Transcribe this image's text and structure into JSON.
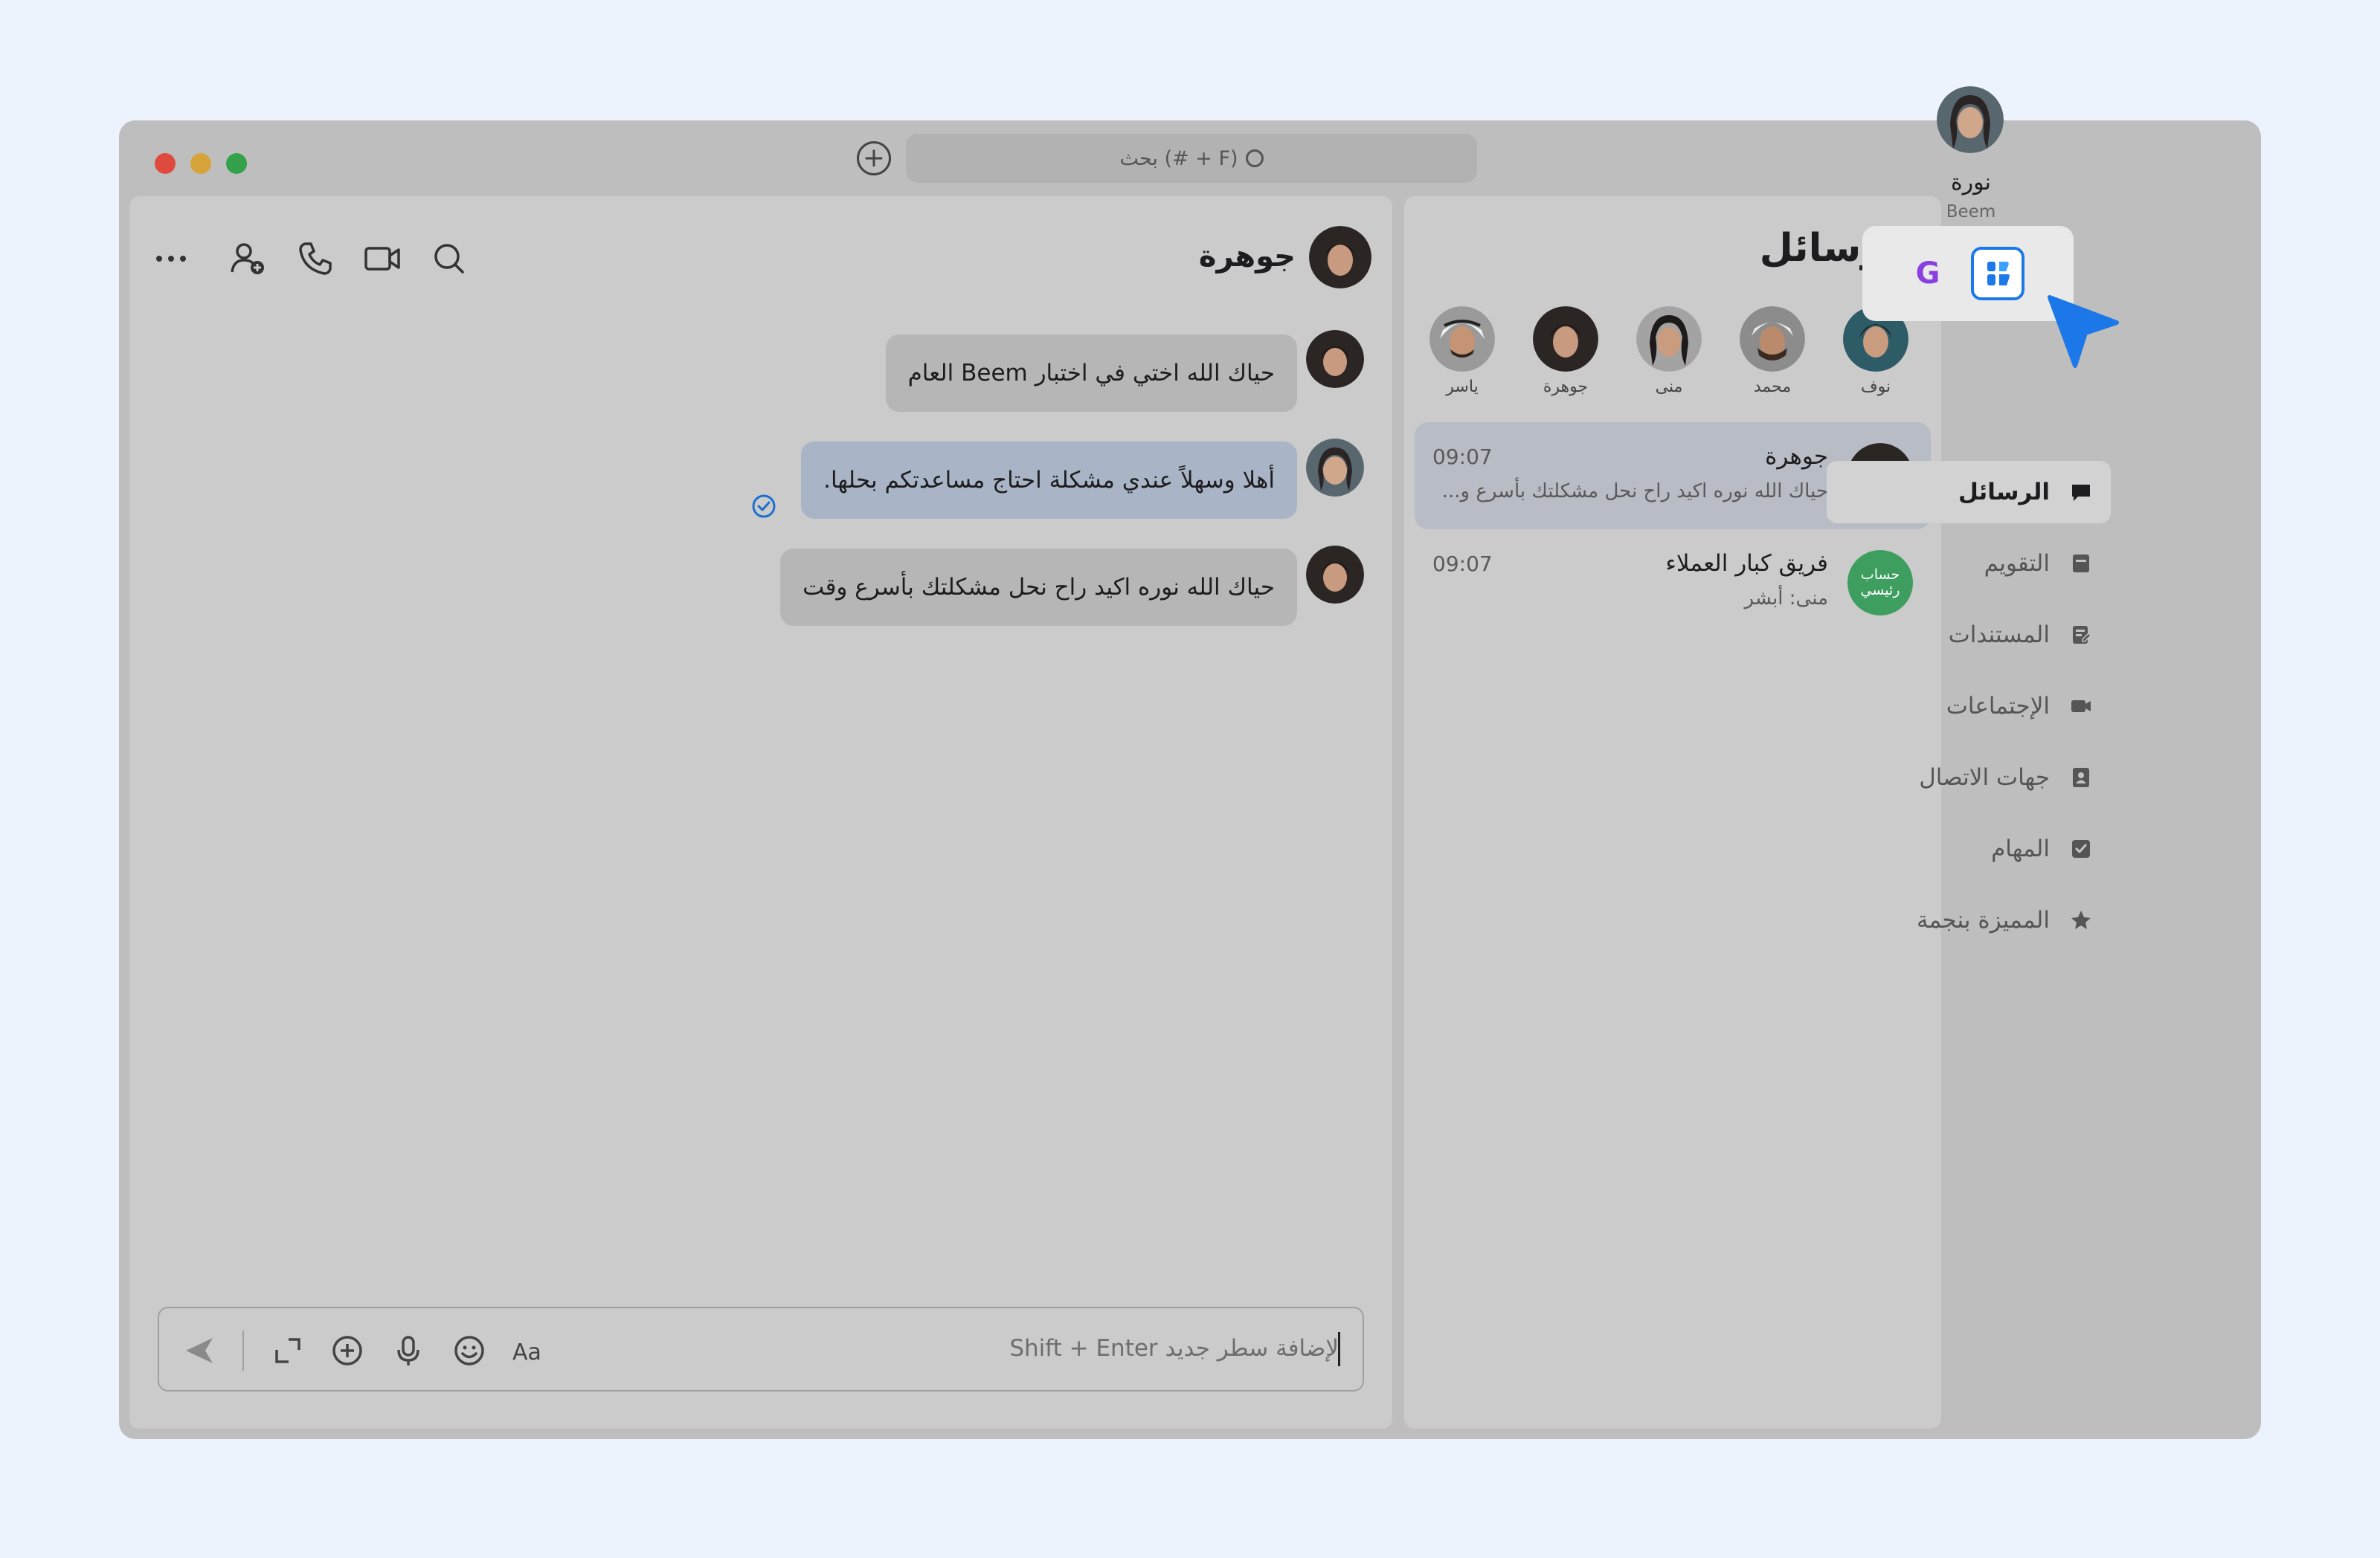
{
  "window": {
    "search_placeholder": "بحث (# + F)"
  },
  "chat": {
    "title": "جوهرة",
    "messages": [
      {
        "text": "حياك الله اختي في اختبار Beem العام",
        "sender": "جوهرة"
      },
      {
        "text": "أهلا وسهلاً عندي مشكلة احتاج مساعدتكم بحلها.",
        "sender": "نورة",
        "status": "read"
      },
      {
        "text": "حياك الله نوره اكيد راح نحل مشكلتك بأسرع وقت",
        "sender": "جوهرة"
      }
    ],
    "composer_placeholder": "Shift + Enter  لإضافة سطر جديد"
  },
  "messages_panel": {
    "title": "الرسائل",
    "stories": [
      {
        "name": "نوف"
      },
      {
        "name": "محمد"
      },
      {
        "name": "منى"
      },
      {
        "name": "جوهرة"
      },
      {
        "name": "ياسر"
      }
    ],
    "conversations": [
      {
        "name": "جوهرة",
        "preview": "حياك الله نوره اكيد راح نحل مشكلتك بأسرع و...",
        "time": "09:07",
        "selected": true
      },
      {
        "name": "فريق كبار العملاء",
        "preview": "منى: أبشر",
        "time": "09:07",
        "avatar_text": "حساب رئيسي"
      }
    ]
  },
  "sidebar": {
    "user_name": "نورة",
    "org": "Beem",
    "workspaces": {
      "google_letter": "G"
    },
    "nav": [
      {
        "label": "الرسائل",
        "icon": "chat-icon",
        "active": true
      },
      {
        "label": "التقويم",
        "icon": "calendar-icon"
      },
      {
        "label": "المستندات",
        "icon": "documents-icon"
      },
      {
        "label": "الإجتماعات",
        "icon": "video-icon"
      },
      {
        "label": "جهات الاتصال",
        "icon": "contacts-icon"
      },
      {
        "label": "المهام",
        "icon": "checkbox-icon"
      },
      {
        "label": "المميزة بنجمة",
        "icon": "star-icon"
      }
    ]
  },
  "colors": {
    "accent": "#1c78e8",
    "sent_bubble": "#a9b5c6",
    "group_avatar": "#3d9e5f"
  }
}
